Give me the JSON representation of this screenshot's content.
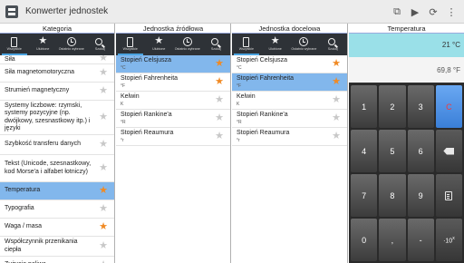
{
  "app": {
    "title": "Konwerter jednostek",
    "icon": "app-list-icon"
  },
  "actions": [
    {
      "name": "copy-icon",
      "glyph": "⧉"
    },
    {
      "name": "play-icon",
      "glyph": "▶"
    },
    {
      "name": "refresh-icon",
      "glyph": "⟳"
    },
    {
      "name": "overflow-menu-icon",
      "glyph": "⋮"
    }
  ],
  "tabs": {
    "all": "Wszystkie",
    "favorites": "Ulubione",
    "recent": "Ostatnio wybrane",
    "search": "Szukaj"
  },
  "category_panel": {
    "title": "Kategoria",
    "items": [
      {
        "name": "Siła",
        "starred": false,
        "selected": false,
        "partial": true
      },
      {
        "name": "Siła magnetomotoryczna",
        "starred": false,
        "selected": false
      },
      {
        "name": "Strumień magnetyczny",
        "starred": false,
        "selected": false
      },
      {
        "name": "Systemy liczbowe: rzymski, systemy pozycyjne (np. dwójkowy, szesnastkowy itp.) i języki",
        "starred": false,
        "selected": false
      },
      {
        "name": "Szybkość transferu danych",
        "starred": false,
        "selected": false
      },
      {
        "name": "Tekst (Unicode, szesnastkowy, kod Morse'a i alfabet łotniczy)",
        "starred": false,
        "selected": false
      },
      {
        "name": "Temperatura",
        "starred": true,
        "selected": true
      },
      {
        "name": "Typografia",
        "starred": false,
        "selected": false
      },
      {
        "name": "Waga / masa",
        "starred": true,
        "selected": false
      },
      {
        "name": "Współczynnik przenikania ciepła",
        "starred": false,
        "selected": false
      },
      {
        "name": "Zużycie paliwa",
        "starred": false,
        "selected": false
      }
    ]
  },
  "source_panel": {
    "title": "Jednostka źródłowa",
    "items": [
      {
        "name": "Stopień Celsjusza",
        "symbol": "°C",
        "starred": true,
        "selected": true
      },
      {
        "name": "Stopień Fahrenheita",
        "symbol": "°F",
        "starred": true,
        "selected": false
      },
      {
        "name": "Kelwin",
        "symbol": "K",
        "starred": false,
        "selected": false
      },
      {
        "name": "Stopień Rankine'a",
        "symbol": "°R",
        "starred": false,
        "selected": false
      },
      {
        "name": "Stopień Reaumura",
        "symbol": "°r",
        "starred": false,
        "selected": false
      }
    ]
  },
  "target_panel": {
    "title": "Jednostka docelowa",
    "items": [
      {
        "name": "Stopień Celsjusza",
        "symbol": "°C",
        "starred": true,
        "selected": false
      },
      {
        "name": "Stopień Fahrenheita",
        "symbol": "°F",
        "starred": true,
        "selected": true
      },
      {
        "name": "Kelwin",
        "symbol": "K",
        "starred": false,
        "selected": false
      },
      {
        "name": "Stopień Rankine'a",
        "symbol": "°R",
        "starred": false,
        "selected": false
      },
      {
        "name": "Stopień Reaumura",
        "symbol": "°r",
        "starred": false,
        "selected": false
      }
    ]
  },
  "calculator": {
    "title": "Temperatura",
    "input_value": "21 °C",
    "output_value": "69,8 °F",
    "keys": [
      "1",
      "2",
      "3",
      "C",
      "4",
      "5",
      "6",
      "⌫",
      "7",
      "8",
      "9",
      "clipboard",
      "0",
      ",",
      "-",
      "10^x"
    ],
    "accent_color": "#82b7ec",
    "clear_color": "#f23b3b",
    "star_color": "#f08a24"
  }
}
